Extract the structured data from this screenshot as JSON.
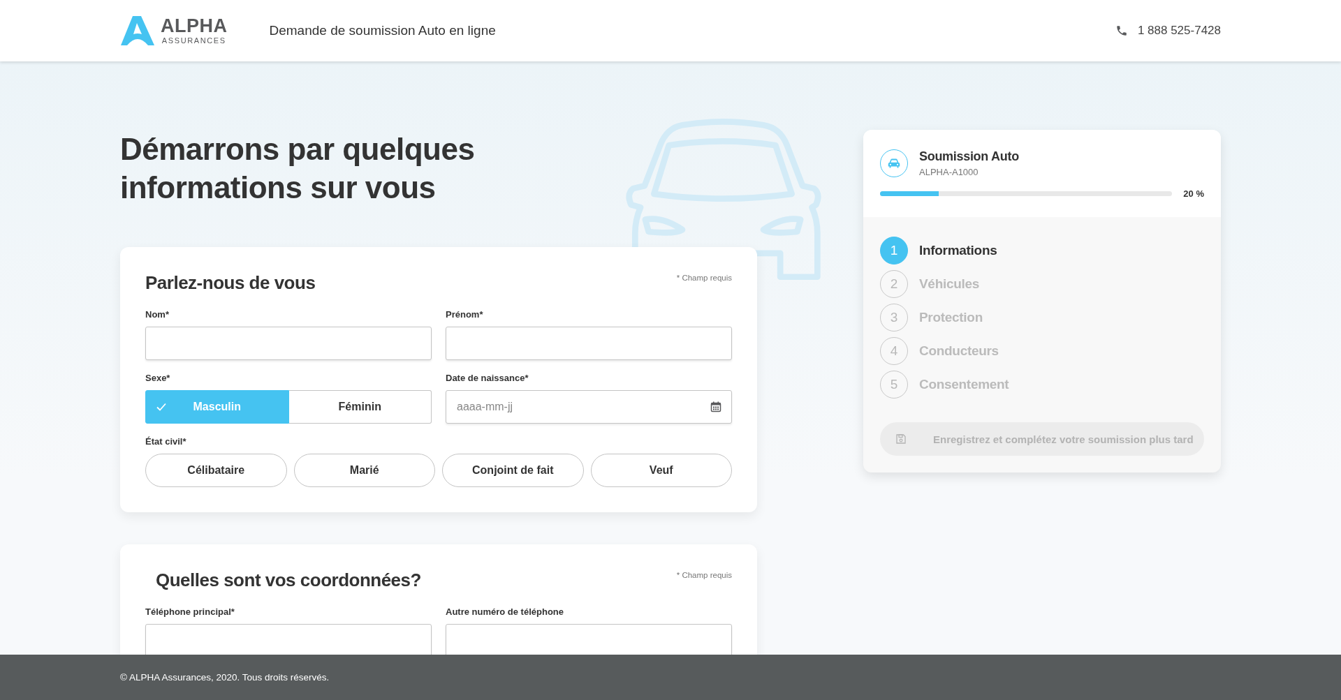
{
  "header": {
    "logo_name": "ALPHA",
    "logo_sub": "ASSURANCES",
    "title": "Demande de soumission Auto en ligne",
    "phone": "1 888 525-7428"
  },
  "heading": "Démarrons par quelques informations sur vous",
  "cards": [
    {
      "title": "Parlez-nous de vous",
      "required_note": "* Champ requis",
      "rows": [
        {
          "kind": "fields",
          "items": [
            {
              "label": "Nom*",
              "kind": "text"
            },
            {
              "label": "Prénom*",
              "kind": "text"
            }
          ]
        },
        {
          "kind": "fields",
          "items": [
            {
              "label": "Sexe*",
              "kind": "toggle",
              "options": [
                {
                  "label": "Masculin",
                  "selected": true
                },
                {
                  "label": "Féminin",
                  "selected": false
                }
              ]
            },
            {
              "label": "Date de naissance*",
              "kind": "date",
              "placeholder": "aaaa-mm-jj"
            }
          ]
        },
        {
          "kind": "pills",
          "label": "État civil*",
          "options": [
            {
              "label": "Célibataire",
              "selected": false
            },
            {
              "label": "Marié",
              "selected": false
            },
            {
              "label": "Conjoint de fait",
              "selected": false
            },
            {
              "label": "Veuf",
              "selected": false
            }
          ]
        }
      ]
    },
    {
      "title": "Quelles sont vos coordonnées?",
      "required_note": "* Champ requis",
      "rows": [
        {
          "kind": "fields",
          "items": [
            {
              "label": "Téléphone principal*",
              "kind": "text"
            },
            {
              "label": "Autre numéro de téléphone",
              "kind": "text"
            }
          ]
        }
      ]
    }
  ],
  "summary": {
    "title": "Soumission Auto",
    "reference": "ALPHA-A1000",
    "progress": {
      "level": 0.2,
      "reading": "20 %"
    },
    "steps": [
      {
        "number": "1",
        "label": "Informations",
        "selected": true
      },
      {
        "number": "2",
        "label": "Véhicules",
        "selected": false
      },
      {
        "number": "3",
        "label": "Protection",
        "selected": false
      },
      {
        "number": "4",
        "label": "Conducteurs",
        "selected": false
      },
      {
        "number": "5",
        "label": "Consentement",
        "selected": false
      }
    ],
    "save_button": {
      "label": "Enregistrez et complétez votre soumission plus tard",
      "disabled": true
    }
  },
  "footer": "© ALPHA Assurances, 2020. Tous droits réservés."
}
